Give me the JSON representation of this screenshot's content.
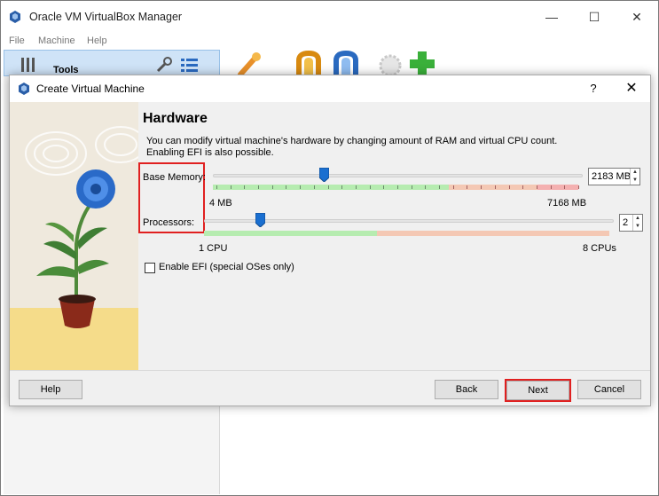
{
  "main_window": {
    "title": "Oracle VM VirtualBox Manager",
    "menu": [
      "File",
      "Machine",
      "Help"
    ],
    "tools_label": "Tools",
    "controls": {
      "minimize": "—",
      "maximize": "☐",
      "close": "✕"
    }
  },
  "dialog": {
    "title": "Create Virtual Machine",
    "help_glyph": "?",
    "close_glyph": "✕",
    "heading": "Hardware",
    "description": "You can modify virtual machine's hardware by changing amount of RAM and virtual CPU count. Enabling EFI is also possible.",
    "base_memory": {
      "label": "Base Memory:",
      "value": "2183",
      "unit": "MB",
      "min_label": "4 MB",
      "max_label": "7168 MB",
      "slider_fraction": 0.3
    },
    "processors": {
      "label": "Processors:",
      "value": "2",
      "min_label": "1 CPU",
      "max_label": "8 CPUs",
      "slider_fraction": 0.143
    },
    "efi": {
      "label": "Enable EFI (special OSes only)",
      "checked": false
    },
    "buttons": {
      "help": "Help",
      "back": "Back",
      "next": "Next",
      "cancel": "Cancel"
    },
    "highlight_color": "#e02020"
  }
}
